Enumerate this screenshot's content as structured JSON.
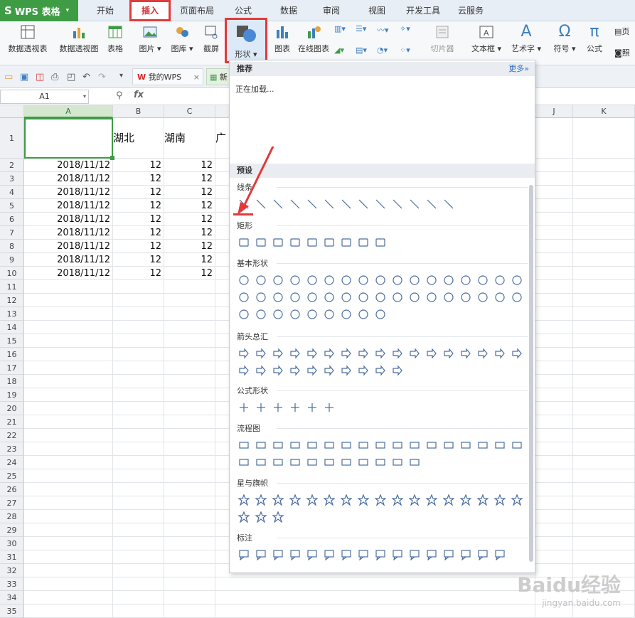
{
  "app": {
    "name": "WPS 表格"
  },
  "tabs": [
    "开始",
    "插入",
    "页面布局",
    "公式",
    "数据",
    "审阅",
    "视图",
    "开发工具",
    "云服务"
  ],
  "ribbon": {
    "buttons": [
      "数据透视表",
      "数据透视图",
      "表格",
      "图片",
      "图库",
      "截屏",
      "形状",
      "图表",
      "在线图表",
      "切片器",
      "文本框",
      "艺术字",
      "符号",
      "公式"
    ],
    "extra": [
      "页",
      "照"
    ]
  },
  "quickbar": {
    "doc1": "我的WPS",
    "doc2": "新"
  },
  "formula_bar": {
    "name_box": "A1",
    "fx": "fx"
  },
  "grid": {
    "columns": [
      "A",
      "B",
      "C",
      "J",
      "K"
    ],
    "header_row": {
      "b": "湖北",
      "c": "湖南",
      "d": "广"
    },
    "date": "2018/11/12",
    "value": "12",
    "row_numbers": [
      "1",
      "2",
      "3",
      "4",
      "5",
      "6",
      "7",
      "8",
      "9",
      "10",
      "11",
      "12",
      "13",
      "14",
      "15",
      "16",
      "17",
      "18",
      "19",
      "20",
      "21",
      "22",
      "23",
      "24",
      "25",
      "26",
      "27",
      "28",
      "29",
      "30",
      "31",
      "32",
      "33",
      "34",
      "35"
    ]
  },
  "dropdown": {
    "recommend_title": "推荐",
    "more": "更多»",
    "loading": "正在加载...",
    "preset_title": "预设",
    "categories": [
      "线条",
      "矩形",
      "基本形状",
      "箭头总汇",
      "公式形状",
      "流程图",
      "星与旗帜",
      "标注"
    ]
  },
  "watermark": {
    "text": "Baidu经验",
    "sub": "jingyan.baidu.com"
  },
  "colors": {
    "accent": "#3e9c45",
    "highlight": "#e23a3a",
    "link": "#2f6fc0"
  }
}
